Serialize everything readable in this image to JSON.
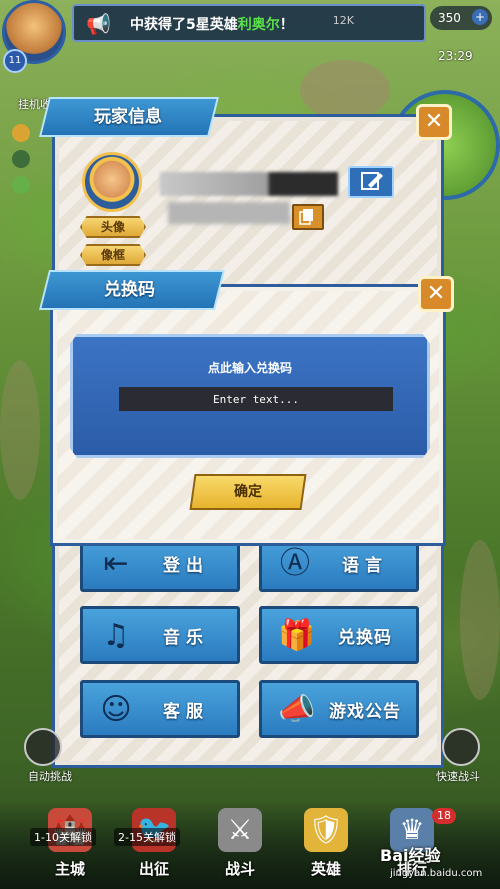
{
  "topbar": {
    "level": "11",
    "ticker_prefix": "中获得了5星英雄",
    "ticker_highlight": "利奥尔",
    "ticker_suffix": "！",
    "resource": "12K",
    "gems": "350",
    "time": "23:29",
    "side_label": "挂机收益"
  },
  "player_panel": {
    "title": "玩家信息",
    "avatar_label": "头像",
    "frame_label": "像框"
  },
  "menu": [
    {
      "label": "登出",
      "icon": "logout-icon"
    },
    {
      "label": "语言",
      "icon": "language-icon"
    },
    {
      "label": "音乐",
      "icon": "music-icon"
    },
    {
      "label": "兑换码",
      "icon": "gift-icon"
    },
    {
      "label": "客服",
      "icon": "support-icon"
    },
    {
      "label": "游戏公告",
      "icon": "megaphone-icon"
    }
  ],
  "redeem_panel": {
    "title": "兑换码",
    "prompt": "点此输入兑换码",
    "placeholder": "Enter text...",
    "confirm_label": "确定"
  },
  "bottom": {
    "auto_battle": "自动挑战",
    "quick_battle": "快速战斗",
    "lock1": "1-10关解锁",
    "lock2": "2-15关解锁",
    "nav": [
      "主城",
      "出征",
      "战斗",
      "英雄",
      "排行"
    ],
    "badge": "18",
    "watermark": "Bai经验",
    "watermark_sub": "jingyan.baidu.com"
  }
}
